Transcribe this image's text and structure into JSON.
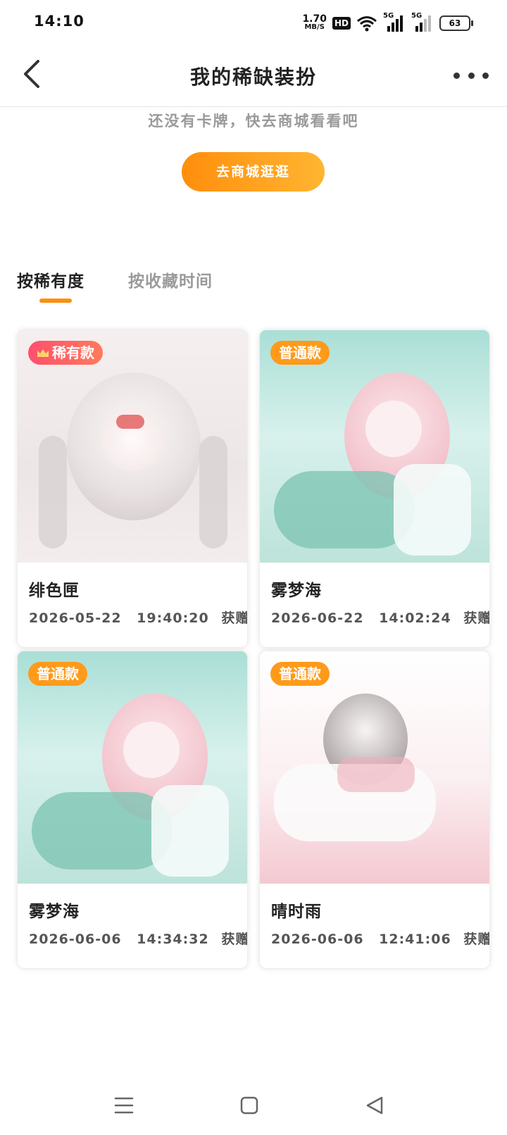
{
  "status_bar": {
    "time": "14:10",
    "net_speed_value": "1.70",
    "net_speed_unit": "MB/S",
    "hd_label": "HD",
    "signal1_label": "5G",
    "signal2_label": "5G",
    "battery": "63"
  },
  "header": {
    "title": "我的稀缺装扮",
    "back_icon": "chevron-left-icon",
    "more_icon": "more-dots-icon"
  },
  "empty_state": {
    "message": "还没有卡牌，快去商城看看吧",
    "shop_button": "去商城逛逛"
  },
  "tabs": [
    {
      "label": "按稀有度",
      "active": true
    },
    {
      "label": "按收藏时间",
      "active": false
    }
  ],
  "cards": [
    {
      "badge": "稀有款",
      "badge_type": "rare",
      "name": "绯色匣",
      "date": "2026-05-22",
      "time": "19:40:20",
      "source": "获赠",
      "palette": "#f4d2d2"
    },
    {
      "badge": "普通款",
      "badge_type": "common",
      "name": "雾梦海",
      "date": "2026-06-22",
      "time": "14:02:24",
      "source": "获赠",
      "palette": "#bfe6df"
    },
    {
      "badge": "普通款",
      "badge_type": "common",
      "name": "雾梦海",
      "date": "2026-06-06",
      "time": "14:34:32",
      "source": "获赠",
      "palette": "#bfe6df"
    },
    {
      "badge": "普通款",
      "badge_type": "common",
      "name": "晴时雨",
      "date": "2026-06-06",
      "time": "12:41:06",
      "source": "获赠",
      "palette": "#f6dde2"
    }
  ],
  "colors": {
    "accent": "#ff8e0c",
    "rare_badge": "#ff4f6d",
    "common_badge": "#ff9a1a"
  },
  "nav_bar": {
    "menu_icon": "menu-icon",
    "home_icon": "home-square-icon",
    "back_icon": "back-triangle-icon"
  }
}
